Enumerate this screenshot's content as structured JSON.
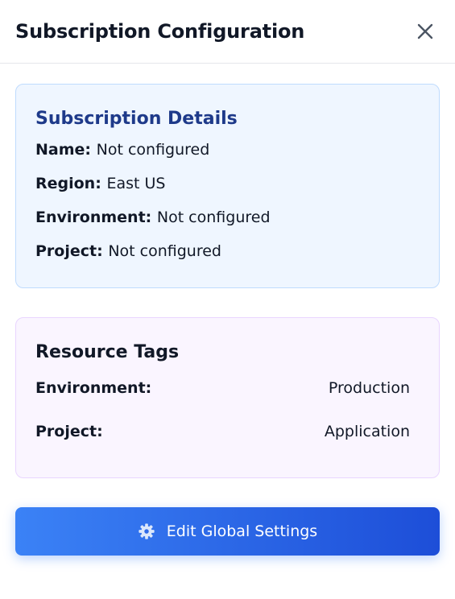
{
  "header": {
    "title": "Subscription Configuration",
    "close_icon": "close-icon"
  },
  "details": {
    "title": "Subscription Details",
    "rows": [
      {
        "label": "Name:",
        "value": "Not configured"
      },
      {
        "label": "Region:",
        "value": "East US"
      },
      {
        "label": "Environment:",
        "value": "Not configured"
      },
      {
        "label": "Project:",
        "value": "Not configured"
      }
    ]
  },
  "tags": {
    "title": "Resource Tags",
    "rows": [
      {
        "label": "Environment:",
        "value": "Production"
      },
      {
        "label": "Project:",
        "value": "Application"
      }
    ]
  },
  "actions": {
    "edit_label": "Edit Global Settings",
    "edit_icon": "gear-icon"
  },
  "colors": {
    "accent": "#3b82f6",
    "accent_dark": "#1d4ed8",
    "details_bg": "#eff6ff",
    "details_title": "#1e3a8a",
    "tags_bg": "#faf5ff"
  }
}
